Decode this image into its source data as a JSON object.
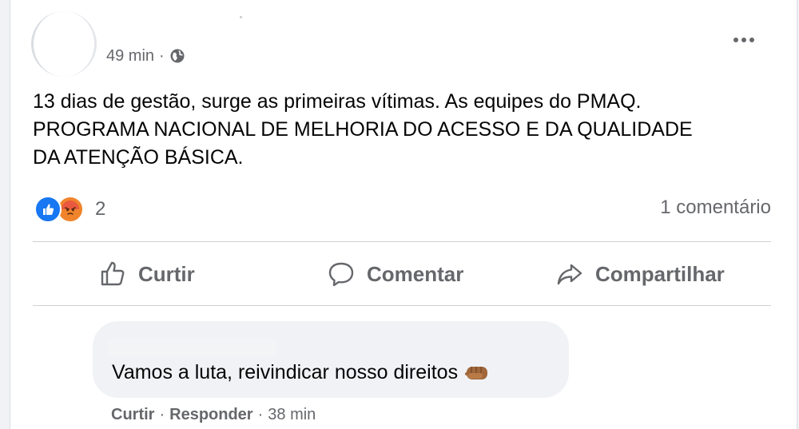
{
  "post": {
    "time": "49 min",
    "meta_separator": "·",
    "privacy_icon": "globe-icon",
    "more_icon": "more-options-icon",
    "text_lines": [
      "13 dias de gestão, surge as primeiras vítimas. As equipes do PMAQ.",
      "PROGRAMA NACIONAL DE MELHORIA DO ACESSO E DA QUALIDADE",
      "DA ATENÇÃO BÁSICA."
    ]
  },
  "reactions": {
    "icons": [
      "like-reaction-icon",
      "angry-reaction-icon"
    ],
    "count": "2",
    "comments": "1 comentário"
  },
  "actions": {
    "like": "Curtir",
    "comment": "Comentar",
    "share": "Compartilhar"
  },
  "comment": {
    "text": "Vamos a luta, reivindicar nosso direitos",
    "emoji_icon": "raised-fist-emoji-icon",
    "like": "Curtir",
    "sep1": "·",
    "reply": "Responder",
    "sep2": "·",
    "time": "38 min"
  },
  "colors": {
    "background": "#f0f2f5",
    "card": "#ffffff",
    "secondary_text": "#65676b",
    "like_blue": "#1877f2",
    "angry_orange": "#f0842c"
  }
}
